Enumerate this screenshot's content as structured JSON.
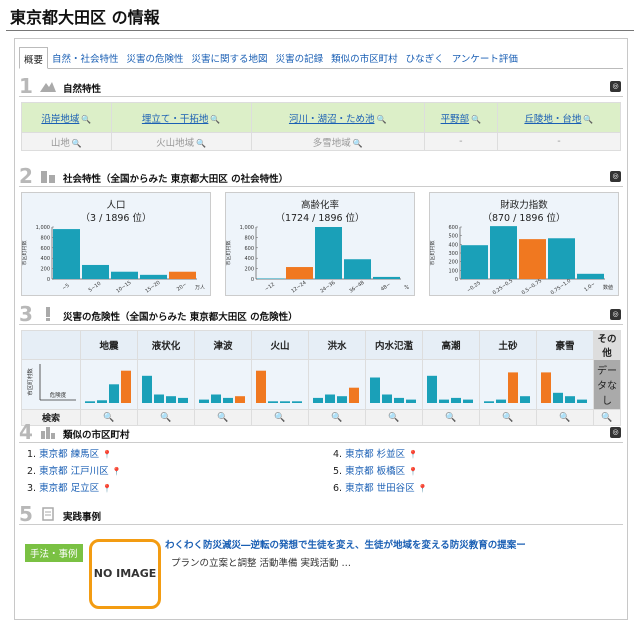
{
  "header": {
    "title": "東京都大田区 の情報"
  },
  "tabs": [
    {
      "label": "概要"
    },
    {
      "label": "自然・社会特性"
    },
    {
      "label": "災害の危険性"
    },
    {
      "label": "災害に関する地図"
    },
    {
      "label": "災害の記録"
    },
    {
      "label": "類似の市区町村"
    },
    {
      "label": "ひなぎく"
    },
    {
      "label": "アンケート評価"
    }
  ],
  "sections": {
    "s1": {
      "num": "1",
      "label": "自然特性"
    },
    "s2": {
      "num": "2",
      "label": "社会特性（全国からみた 東京都大田区 の社会特性）"
    },
    "s3": {
      "num": "3",
      "label": "災害の危険性（全国からみた 東京都大田区 の危険性）"
    },
    "s4": {
      "num": "4",
      "label": "類似の市区町村"
    },
    "s5": {
      "num": "5",
      "label": "実践事例"
    }
  },
  "natural": {
    "row1": [
      "沿岸地域",
      "埋立て・干拓地",
      "河川・湖沼・ため池",
      "平野部",
      "丘陵地・台地"
    ],
    "row2": [
      "山地",
      "火山地域",
      "多雪地域",
      "-",
      "-"
    ]
  },
  "social": [
    {
      "title": "人口",
      "rank": "（3 / 1896 位）",
      "ylabel": "市区町村数",
      "yticks": [
        "1,000",
        "800",
        "600",
        "400",
        "200",
        "0"
      ],
      "xticks": [
        "~5",
        "5~10",
        "10~15",
        "15~20",
        "20~"
      ],
      "unit": "万人",
      "values": [
        960,
        270,
        140,
        80,
        140
      ],
      "highlight": 4,
      "ymax": 1000
    },
    {
      "title": "高齢化率",
      "rank": "（1724 / 1896 位）",
      "ylabel": "市区町村数",
      "yticks": [
        "1,000",
        "800",
        "600",
        "400",
        "200",
        "0"
      ],
      "xticks": [
        "~12",
        "12~24",
        "24~36",
        "36~48",
        "48~"
      ],
      "unit": "%",
      "values": [
        10,
        230,
        1000,
        380,
        40
      ],
      "highlight": 1,
      "ymax": 1000
    },
    {
      "title": "財政力指数",
      "rank": "（870 / 1896 位）",
      "ylabel": "市区町村数",
      "yticks": [
        "600",
        "500",
        "400",
        "300",
        "200",
        "100",
        "0"
      ],
      "xticks": [
        "~0.25",
        "0.25~0.5",
        "0.5~0.75",
        "0.75~1.0",
        "1.0~"
      ],
      "unit": "数値",
      "values": [
        390,
        610,
        460,
        470,
        60
      ],
      "highlight": 2,
      "ymax": 600
    }
  ],
  "hazard": {
    "axis_y": "市区町村数",
    "axis_x": "危険度",
    "search_label": "検索",
    "columns": [
      {
        "name": "地震",
        "values": [
          5,
          8,
          55,
          95
        ],
        "hl": 3
      },
      {
        "name": "液状化",
        "values": [
          80,
          25,
          20,
          15
        ],
        "hl": -1
      },
      {
        "name": "津波",
        "values": [
          10,
          25,
          15,
          20
        ],
        "hl": 3
      },
      {
        "name": "火山",
        "values": [
          95,
          5,
          5,
          5
        ],
        "hl": 0
      },
      {
        "name": "洪水",
        "values": [
          15,
          25,
          20,
          45
        ],
        "hl": 3
      },
      {
        "name": "内水氾濫",
        "values": [
          75,
          25,
          15,
          10
        ],
        "hl": -1
      },
      {
        "name": "高潮",
        "values": [
          80,
          10,
          15,
          10
        ],
        "hl": -1
      },
      {
        "name": "土砂",
        "values": [
          5,
          10,
          90,
          20
        ],
        "hl": 2
      },
      {
        "name": "豪雪",
        "values": [
          90,
          30,
          20,
          10
        ],
        "hl": 0
      }
    ],
    "other": {
      "name": "その他",
      "text": "データなし"
    }
  },
  "similar": [
    {
      "no": "1.",
      "pref": "東京都",
      "city": "練馬区"
    },
    {
      "no": "2.",
      "pref": "東京都",
      "city": "江戸川区"
    },
    {
      "no": "3.",
      "pref": "東京都",
      "city": "足立区"
    },
    {
      "no": "4.",
      "pref": "東京都",
      "city": "杉並区"
    },
    {
      "no": "5.",
      "pref": "東京都",
      "city": "板橋区"
    },
    {
      "no": "6.",
      "pref": "東京都",
      "city": "世田谷区"
    }
  ],
  "practice": {
    "badge": "手法・事例",
    "image_text": "NO IMAGE",
    "title": "わくわく防災減災―逆転の発想で生徒を変え、生徒が地域を変える防災教育の提案ー",
    "tags": "プランの立案と調整  活動準備  実践活動  …"
  },
  "colors": {
    "bar": "#1aa0b8",
    "highlight": "#f07820",
    "link": "#1a5fb4",
    "green": "#7ac143"
  }
}
